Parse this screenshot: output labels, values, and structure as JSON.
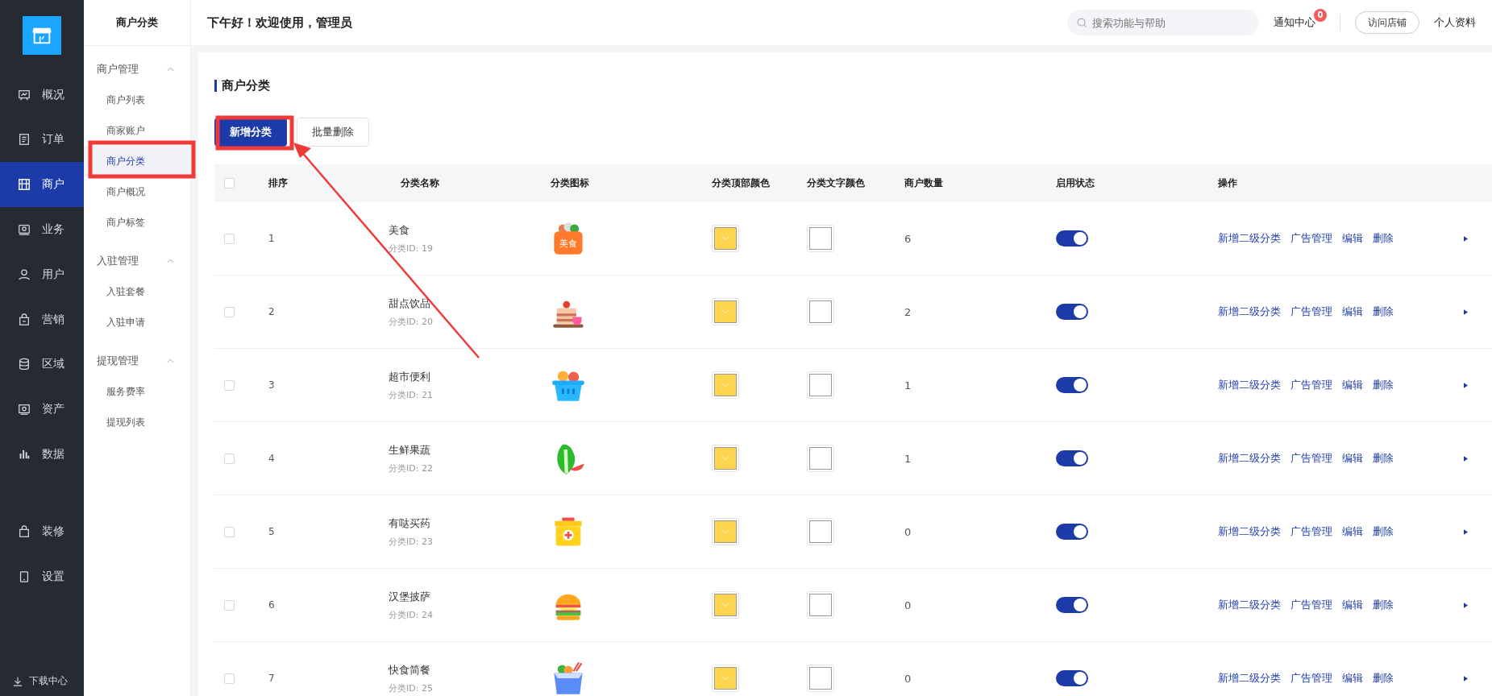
{
  "nav": {
    "items": [
      {
        "label": "概况",
        "selected": false
      },
      {
        "label": "订单",
        "selected": false
      },
      {
        "label": "商户",
        "selected": true
      },
      {
        "label": "业务",
        "selected": false
      },
      {
        "label": "用户",
        "selected": false
      },
      {
        "label": "营销",
        "selected": false
      },
      {
        "label": "区域",
        "selected": false
      },
      {
        "label": "资产",
        "selected": false
      },
      {
        "label": "数据",
        "selected": false
      }
    ],
    "bottom_items": [
      {
        "label": "装修",
        "selected": false
      },
      {
        "label": "设置",
        "selected": false
      }
    ],
    "download": "下载中心"
  },
  "submenu": {
    "title": "商户分类",
    "groups": [
      {
        "label": "商户管理",
        "expanded": true,
        "items": [
          {
            "label": "商户列表",
            "selected": false
          },
          {
            "label": "商家账户",
            "selected": false
          },
          {
            "label": "商户分类",
            "selected": true
          },
          {
            "label": "商户概况",
            "selected": false
          },
          {
            "label": "商户标签",
            "selected": false
          }
        ]
      },
      {
        "label": "入驻管理",
        "expanded": true,
        "items": [
          {
            "label": "入驻套餐",
            "selected": false
          },
          {
            "label": "入驻申请",
            "selected": false
          }
        ]
      },
      {
        "label": "提现管理",
        "expanded": true,
        "items": [
          {
            "label": "服务费率",
            "selected": false
          },
          {
            "label": "提现列表",
            "selected": false
          }
        ]
      }
    ]
  },
  "header": {
    "greeting": "下午好！欢迎使用，管理员",
    "search": {
      "placeholder": "搜索功能与帮助"
    },
    "notifications": {
      "label": "通知中心",
      "count": "0"
    },
    "visit_store": "访问店铺",
    "profile": "个人资料"
  },
  "page": {
    "title": "商户分类",
    "buttons": [
      {
        "label": "新增分类",
        "kind": "primary"
      },
      {
        "label": "批量删除",
        "kind": "default"
      }
    ]
  },
  "table": {
    "select_all": {
      "checked": false
    },
    "columns": [
      "排序",
      "分类名称",
      "分类图标",
      "分类顶部颜色",
      "分类文字颜色",
      "商户数量",
      "启用状态",
      "操作"
    ],
    "rows": [
      {
        "checked": false,
        "sort": "1",
        "name": "美食",
        "id": "分类ID: 19",
        "icon_text": "美食",
        "count": "6",
        "on": true,
        "actions": [
          "新增二级分类",
          "广告管理",
          "编辑",
          "删除"
        ]
      },
      {
        "checked": false,
        "sort": "2",
        "name": "甜点饮品",
        "id": "分类ID: 20",
        "count": "2",
        "on": true,
        "actions": [
          "新增二级分类",
          "广告管理",
          "编辑",
          "删除"
        ]
      },
      {
        "checked": false,
        "sort": "3",
        "name": "超市便利",
        "id": "分类ID: 21",
        "count": "1",
        "on": true,
        "actions": [
          "新增二级分类",
          "广告管理",
          "编辑",
          "删除"
        ]
      },
      {
        "checked": false,
        "sort": "4",
        "name": "生鲜果蔬",
        "id": "分类ID: 22",
        "count": "1",
        "on": true,
        "actions": [
          "新增二级分类",
          "广告管理",
          "编辑",
          "删除"
        ]
      },
      {
        "checked": false,
        "sort": "5",
        "name": "有哒买药",
        "id": "分类ID: 23",
        "count": "0",
        "on": true,
        "actions": [
          "新增二级分类",
          "广告管理",
          "编辑",
          "删除"
        ]
      },
      {
        "checked": false,
        "sort": "6",
        "name": "汉堡披萨",
        "id": "分类ID: 24",
        "count": "0",
        "on": true,
        "actions": [
          "新增二级分类",
          "广告管理",
          "编辑",
          "删除"
        ]
      },
      {
        "checked": false,
        "sort": "7",
        "name": "快食简餐",
        "id": "分类ID: 25",
        "count": "0",
        "on": true,
        "actions": [
          "新增二级分类",
          "广告管理",
          "编辑",
          "删除"
        ]
      }
    ]
  }
}
